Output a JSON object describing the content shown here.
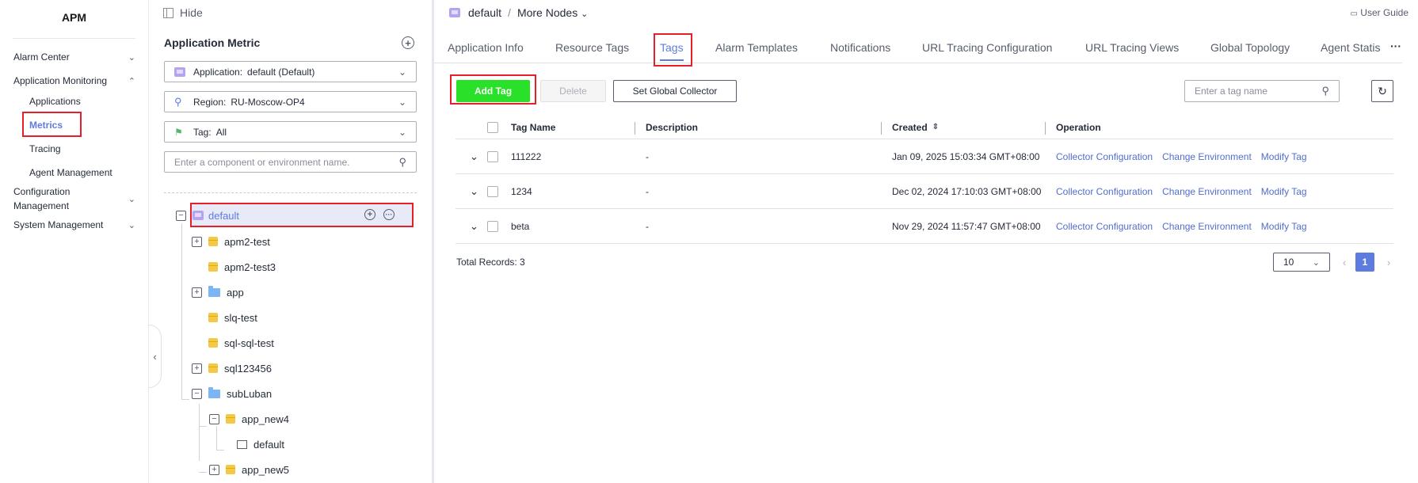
{
  "nav": {
    "brand": "APM",
    "items": [
      {
        "label": "Alarm Center"
      },
      {
        "label": "Application Monitoring"
      },
      {
        "label": "Configuration Management"
      },
      {
        "label": "System Management"
      }
    ],
    "sub": [
      "Applications",
      "Metrics",
      "Tracing",
      "Agent Management"
    ]
  },
  "tree": {
    "hide_label": "Hide",
    "title": "Application Metric",
    "application": {
      "label": "Application:",
      "value": "default (Default)"
    },
    "region": {
      "label": "Region:",
      "value": "RU-Moscow-OP4"
    },
    "tag": {
      "label": "Tag:",
      "value": "All"
    },
    "search_placeholder": "Enter a component or environment name.",
    "nodes": {
      "default": "default",
      "apm2_test": "apm2-test",
      "apm2_test3": "apm2-test3",
      "app": "app",
      "slq_test": "slq-test",
      "sql_sql_test": "sql-sql-test",
      "sql123456": "sql123456",
      "subLuban": "subLuban",
      "app_new4": "app_new4",
      "env_default": "default",
      "app_new5": "app_new5"
    }
  },
  "main": {
    "breadcrumb": {
      "app": "default",
      "separator": "/",
      "more": "More Nodes"
    },
    "user_guide": "User Guide",
    "tabs": [
      "Application Info",
      "Resource Tags",
      "Tags",
      "Alarm Templates",
      "Notifications",
      "URL Tracing Configuration",
      "URL Tracing Views",
      "Global Topology",
      "Agent Statis"
    ],
    "toolbar": {
      "add_tag": "Add Tag",
      "delete": "Delete",
      "set_global_collector": "Set Global Collector",
      "search_placeholder": "Enter a tag name"
    },
    "table": {
      "headers": {
        "name": "Tag Name",
        "description": "Description",
        "created": "Created",
        "operation": "Operation"
      },
      "rows": [
        {
          "name": "111222",
          "description": "-",
          "created": "Jan 09, 2025 15:03:34 GMT+08:00"
        },
        {
          "name": "1234",
          "description": "-",
          "created": "Dec 02, 2024 17:10:03 GMT+08:00"
        },
        {
          "name": "beta",
          "description": "-",
          "created": "Nov 29, 2024 11:57:47 GMT+08:00"
        }
      ],
      "ops": {
        "collector": "Collector Configuration",
        "env": "Change Environment",
        "modify": "Modify Tag"
      }
    },
    "footer": {
      "total": "Total Records: 3",
      "page_size": "10",
      "page": "1"
    }
  },
  "colors": {
    "accent": "#5e7ce0",
    "add_button": "#28e128",
    "highlight": "#e6202a"
  }
}
